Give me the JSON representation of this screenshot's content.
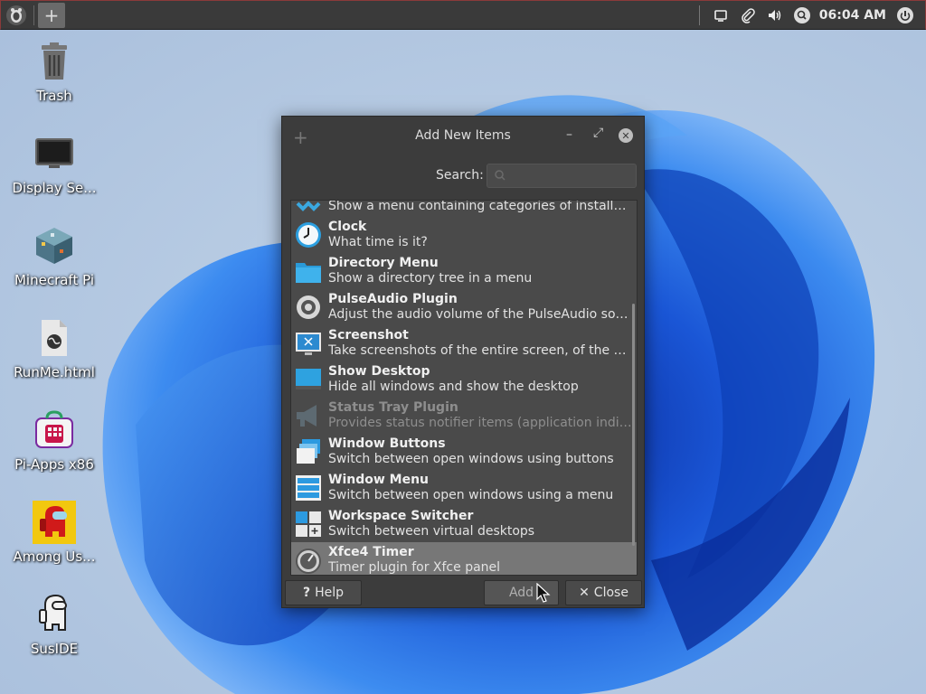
{
  "panel": {
    "clock": "06:04 AM",
    "add_icon": "plus-icon",
    "tray_icons": [
      "window-icon",
      "paperclip-icon",
      "volume-icon",
      "search-icon",
      "power-icon"
    ]
  },
  "desktop": {
    "icons": [
      {
        "label": "Trash",
        "icon": "trash-icon"
      },
      {
        "label": "Display Se...",
        "icon": "monitor-icon"
      },
      {
        "label": "Minecraft Pi",
        "icon": "minecraft-icon"
      },
      {
        "label": "RunMe.html",
        "icon": "html-file-icon"
      },
      {
        "label": "Pi-Apps x86",
        "icon": "pi-apps-icon"
      },
      {
        "label": "Among Us...",
        "icon": "among-us-icon"
      },
      {
        "label": "SusIDE",
        "icon": "suside-icon"
      }
    ]
  },
  "dialog": {
    "title": "Add New Items",
    "search_label": "Search:",
    "search_value": "",
    "search_placeholder": "",
    "items": [
      {
        "name": "",
        "desc": "Show a menu containing categories of installed a...",
        "icon": "applications-menu-icon",
        "state": "partial"
      },
      {
        "name": "Clock",
        "desc": "What time is it?",
        "icon": "clock-icon",
        "state": "normal"
      },
      {
        "name": "Directory Menu",
        "desc": "Show a directory tree in a menu",
        "icon": "folder-icon",
        "state": "normal"
      },
      {
        "name": "PulseAudio Plugin",
        "desc": "Adjust the audio volume of the PulseAudio sound ...",
        "icon": "speaker-icon",
        "state": "normal"
      },
      {
        "name": "Screenshot",
        "desc": "Take screenshots of the entire screen, of the activ...",
        "icon": "screenshot-icon",
        "state": "normal"
      },
      {
        "name": "Show Desktop",
        "desc": "Hide all windows and show the desktop",
        "icon": "show-desktop-icon",
        "state": "normal"
      },
      {
        "name": "Status Tray Plugin",
        "desc": "Provides status notifier items (application indicat...",
        "icon": "megaphone-icon",
        "state": "disabled"
      },
      {
        "name": "Window Buttons",
        "desc": "Switch between open windows using buttons",
        "icon": "window-buttons-icon",
        "state": "normal"
      },
      {
        "name": "Window Menu",
        "desc": "Switch between open windows using a menu",
        "icon": "window-menu-icon",
        "state": "normal"
      },
      {
        "name": "Workspace Switcher",
        "desc": "Switch between virtual desktops",
        "icon": "workspace-icon",
        "state": "normal"
      },
      {
        "name": "Xfce4 Timer",
        "desc": "Timer plugin for Xfce panel",
        "icon": "timer-icon",
        "state": "selected"
      }
    ],
    "buttons": {
      "help": "Help",
      "add": "Add",
      "close": "Close"
    }
  },
  "colors": {
    "panel_bg": "#3a3a3a",
    "dialog_bg": "#3c3c3c",
    "list_bg": "#4a4a4a",
    "selected_row": "#777777",
    "wallpaper_blue": "#1f5fd8"
  }
}
